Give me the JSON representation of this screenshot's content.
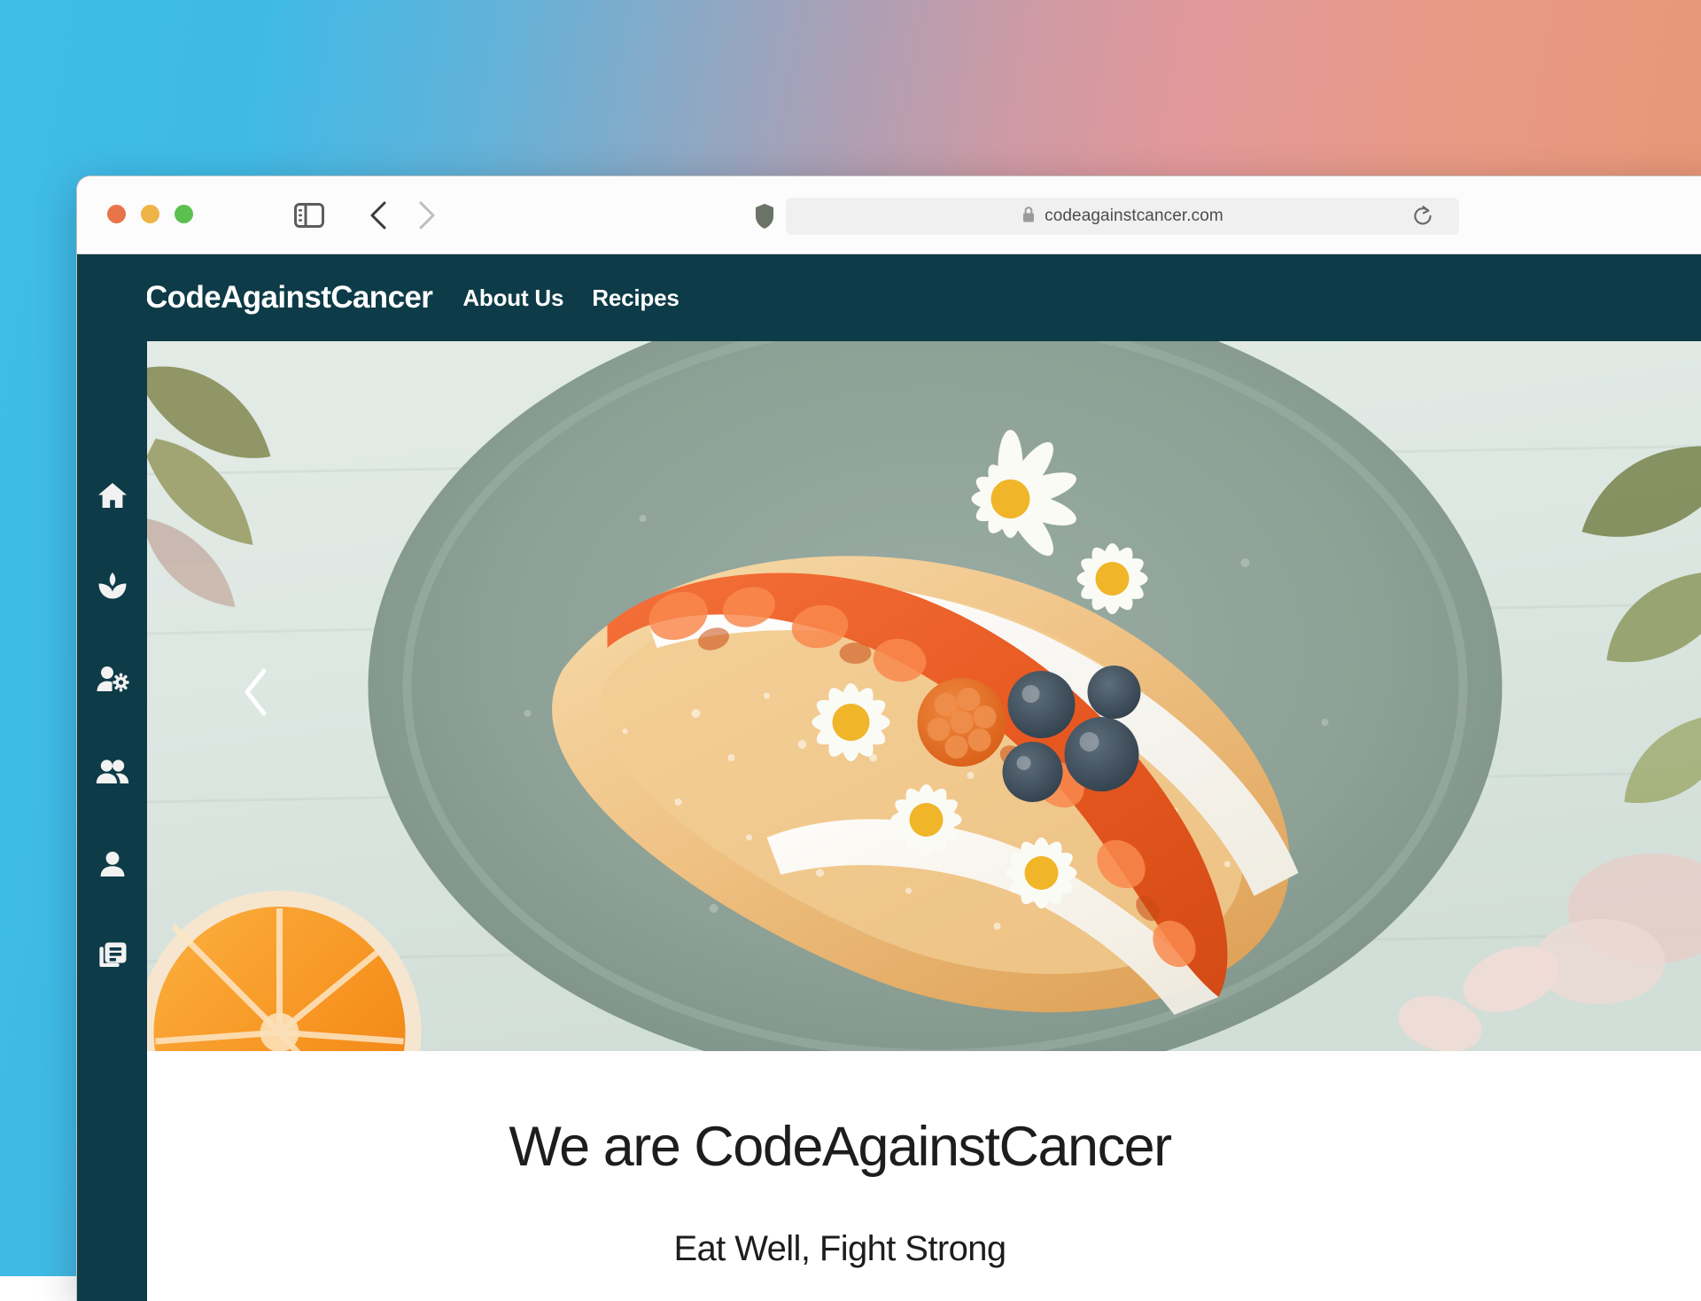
{
  "desktop": {
    "gradient_start": "#3fbce8",
    "gradient_mid": "#cf9aa4",
    "gradient_end": "#e79474"
  },
  "browser": {
    "traffic_lights": [
      {
        "name": "close",
        "color": "#e8744a"
      },
      {
        "name": "minimize",
        "color": "#eeb445"
      },
      {
        "name": "zoom",
        "color": "#5cc04f"
      }
    ],
    "sidebar_toggle_icon": "sidebar-icon",
    "back_icon": "chevron-left-icon",
    "forward_icon": "chevron-right-icon",
    "shield_icon": "privacy-shield-icon",
    "reload_icon": "reload-icon",
    "url": "codeagainstcancer.com",
    "url_lock_icon": "lock-icon"
  },
  "site": {
    "brand_name": "CodeAgainstCancer",
    "brand_logo_icon": "microchip-heart-logo-icon",
    "navbar_color": "#0d3b47",
    "nav_links": [
      {
        "label": "About Us"
      },
      {
        "label": "Recipes"
      }
    ]
  },
  "rail": {
    "background": "#0d3b47",
    "items": [
      {
        "icon": "home-icon",
        "name": "home"
      },
      {
        "icon": "spa-leaf-icon",
        "name": "wellness"
      },
      {
        "icon": "manage-accounts-icon",
        "name": "manage-accounts"
      },
      {
        "icon": "people-group-icon",
        "name": "community"
      },
      {
        "icon": "person-icon",
        "name": "profile"
      },
      {
        "icon": "library-books-icon",
        "name": "articles"
      }
    ]
  },
  "hero": {
    "prev_arrow_icon": "chevron-left-icon",
    "image_alt": "French toast on a grey plate topped with cream, apricot compote, raspberries, blueberries and daisy flowers"
  },
  "intro": {
    "heading": "We are CodeAgainstCancer",
    "subheading": "Eat Well, Fight Strong"
  }
}
